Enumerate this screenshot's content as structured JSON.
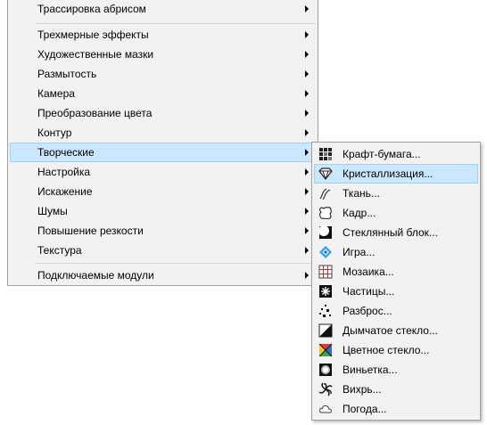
{
  "main_menu": {
    "items": [
      {
        "label": "Трассировка абрисом",
        "arrow": true
      },
      {
        "label": "Трехмерные эффекты",
        "arrow": true
      },
      {
        "label": "Художественные мазки",
        "arrow": true
      },
      {
        "label": "Размытость",
        "arrow": true
      },
      {
        "label": "Камера",
        "arrow": true
      },
      {
        "label": "Преобразование цвета",
        "arrow": true
      },
      {
        "label": "Контур",
        "arrow": true
      },
      {
        "label": "Творческие",
        "arrow": true,
        "highlighted": true
      },
      {
        "label": "Настройка",
        "arrow": true
      },
      {
        "label": "Искажение",
        "arrow": true
      },
      {
        "label": "Шумы",
        "arrow": true
      },
      {
        "label": "Повышение резкости",
        "arrow": true
      },
      {
        "label": "Текстура",
        "arrow": true
      },
      {
        "label": "Подключаемые модули",
        "arrow": true
      }
    ]
  },
  "sub_menu": {
    "items": [
      {
        "label": "Крафт-бумага...",
        "icon": "craft-paper-icon"
      },
      {
        "label": "Кристаллизация...",
        "icon": "crystallize-icon",
        "highlighted": true
      },
      {
        "label": "Ткань...",
        "icon": "fabric-icon"
      },
      {
        "label": "Кадр...",
        "icon": "frame-icon"
      },
      {
        "label": "Стеклянный блок...",
        "icon": "glass-block-icon"
      },
      {
        "label": "Игра...",
        "icon": "game-icon"
      },
      {
        "label": "Мозаика...",
        "icon": "mosaic-icon"
      },
      {
        "label": "Частицы...",
        "icon": "particles-icon"
      },
      {
        "label": "Разброс...",
        "icon": "scatter-icon"
      },
      {
        "label": "Дымчатое стекло...",
        "icon": "smoked-glass-icon"
      },
      {
        "label": "Цветное стекло...",
        "icon": "stained-glass-icon"
      },
      {
        "label": "Виньетка...",
        "icon": "vignette-icon"
      },
      {
        "label": "Вихрь...",
        "icon": "vortex-icon"
      },
      {
        "label": "Погода...",
        "icon": "weather-icon"
      }
    ]
  },
  "colors": {
    "menu_bg": "#f2f2f2",
    "highlight_bg": "#cce8ff",
    "highlight_border": "#99d1ff"
  }
}
